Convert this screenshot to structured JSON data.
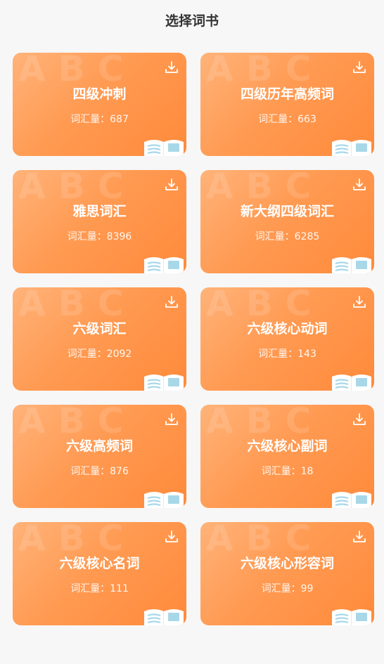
{
  "header": {
    "title": "选择词书"
  },
  "count_label": "词汇量：",
  "colors": {
    "card_start": "#ffb37a",
    "card_end": "#ff8a3a",
    "background": "#f7f7f7"
  },
  "bg_letters": "ABC",
  "books": [
    {
      "name": "四级冲刺",
      "count": "687"
    },
    {
      "name": "四级历年高频词",
      "count": "663"
    },
    {
      "name": "雅思词汇",
      "count": "8396"
    },
    {
      "name": "新大纲四级词汇",
      "count": "6285"
    },
    {
      "name": "六级词汇",
      "count": "2092"
    },
    {
      "name": "六级核心动词",
      "count": "143"
    },
    {
      "name": "六级高频词",
      "count": "876"
    },
    {
      "name": "六级核心副词",
      "count": "18"
    },
    {
      "name": "六级核心名词",
      "count": "111"
    },
    {
      "name": "六级核心形容词",
      "count": "99"
    }
  ]
}
